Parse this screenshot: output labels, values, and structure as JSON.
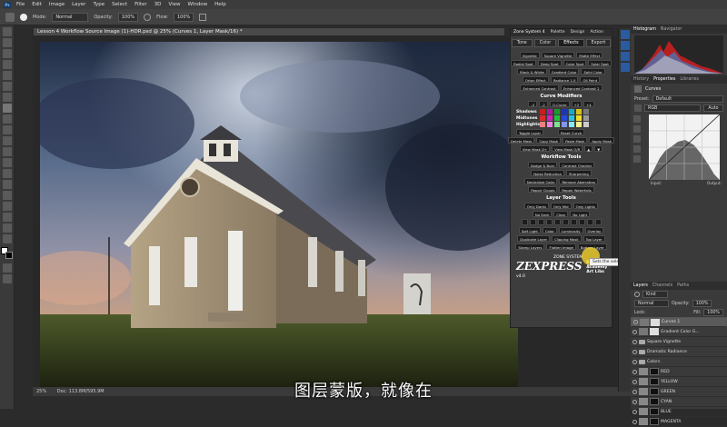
{
  "app": {
    "logo": "Ps"
  },
  "menu": [
    "File",
    "Edit",
    "Image",
    "Layer",
    "Type",
    "Select",
    "Filter",
    "3D",
    "View",
    "Window",
    "Help"
  ],
  "options": {
    "mode_label": "Mode:",
    "mode_value": "Normal",
    "opacity_label": "Opacity:",
    "opacity_value": "100%",
    "flow_label": "Flow:",
    "flow_value": "100%"
  },
  "document": {
    "tab_title": "Lesson 4 Workflow Source Image (1)-HDR.psd @ 25% (Curves 1, Layer Mask/16) *",
    "zoom": "25%",
    "doc_size": "Doc: 113.8M/595.9M"
  },
  "subtitle": "图层蒙版，就像在",
  "zone": {
    "header": [
      "Zone System 4",
      "Palette",
      "Design",
      "Action"
    ],
    "tabs": [
      "Tone",
      "Color",
      "Effects",
      "Export"
    ],
    "effects_rows": [
      [
        "Vignette",
        "Square Vignette",
        "Matte Effect"
      ],
      [
        "Radial Spot",
        "Deep Spot",
        "Color Spot",
        "Solar Spot"
      ],
      [
        "Black & White",
        "Gradient Color",
        "Solid Color"
      ],
      [
        "Orton Effect",
        "Radiance 1.0",
        "Oil Paint"
      ],
      [
        "Enhanced Contrast",
        "Enhanced Contrast 2"
      ]
    ],
    "curve_modifiers_title": "Curve Modifiers",
    "curve_mod_buttons": [
      "-4",
      "-2",
      "O-Curve",
      "+2",
      "+4"
    ],
    "rows_labels": [
      "Shadows",
      "Midtones",
      "Highlights"
    ],
    "mask_rows": [
      [
        "Toggle Layer",
        "Reset Curve"
      ],
      [
        "Delete Mask",
        "Copy Mask",
        "Paste Mask",
        "Apply Mask"
      ],
      [
        "View Mask D+",
        "View Mask O/R"
      ]
    ],
    "workflow_title": "Workflow Tools",
    "workflow_rows": [
      [
        "Dodge & Burn",
        "Contrast Checker"
      ],
      [
        "Noise Reduction",
        "Sharpening"
      ],
      [
        "Neutralize Color",
        "Remove Aberration"
      ],
      [
        "Repair Clouds",
        "Repair Waterfalls"
      ]
    ],
    "layer_title": "Layer Tools",
    "layer_rows": [
      [
        "Only Darks",
        "Only Mid",
        "Only Lights"
      ],
      [
        "No Dark",
        "Clear",
        "No Light"
      ]
    ],
    "layer_rows2": [
      [
        "Soft Light",
        "Color",
        "Luminosity",
        "Overlay"
      ],
      [
        "Duplicate Layer",
        "Clipping Mask",
        "Top Layer"
      ],
      [
        "Stamp Layers",
        "Flatten Image",
        "Bottom Layer"
      ]
    ],
    "logo_text": "ZEXPRESS",
    "logo_version": "v4.0",
    "logo_sub1": "ZONE SYSTEM",
    "logo_sub2": "RH Academy",
    "logo_sub3": "Art Libs",
    "tooltip": "Sets the selected Layer Opacity to 90%"
  },
  "right": {
    "top_tabs": [
      "Histogram",
      "Navigator"
    ],
    "mid_tabs": [
      "History",
      "Properties",
      "Libraries"
    ],
    "props_title": "Curves",
    "preset_label": "Preset:",
    "preset_value": "Default",
    "channel_value": "RGB",
    "auto_label": "Auto",
    "input_label": "Input:",
    "output_label": "Output:",
    "layer_tabs": [
      "Layers",
      "Channels",
      "Paths"
    ],
    "kind_label": "Kind",
    "blend_value": "Normal",
    "opacity_label": "Opacity:",
    "opacity_value": "100%",
    "lock_label": "Lock:",
    "fill_label": "Fill:",
    "fill_value": "100%",
    "layers": [
      {
        "name": "Curves 1",
        "type": "adj",
        "selected": true
      },
      {
        "name": "Gradient Color G...",
        "type": "adj",
        "selected": false
      },
      {
        "name": "Square Vignette",
        "type": "folder",
        "selected": false
      },
      {
        "name": "Dramatic Radiance",
        "type": "folder",
        "selected": false
      },
      {
        "name": "Colors",
        "type": "folder",
        "selected": false
      },
      {
        "name": "RED",
        "type": "mask",
        "selected": false
      },
      {
        "name": "YELLOW",
        "type": "mask",
        "selected": false
      },
      {
        "name": "GREEN",
        "type": "mask",
        "selected": false
      },
      {
        "name": "CYAN",
        "type": "mask",
        "selected": false
      },
      {
        "name": "BLUE",
        "type": "mask",
        "selected": false
      },
      {
        "name": "MAGENTA",
        "type": "mask",
        "selected": false
      }
    ]
  },
  "colors": {
    "accent": "#f2c21b",
    "highlight_ring": "#f5d22a"
  }
}
